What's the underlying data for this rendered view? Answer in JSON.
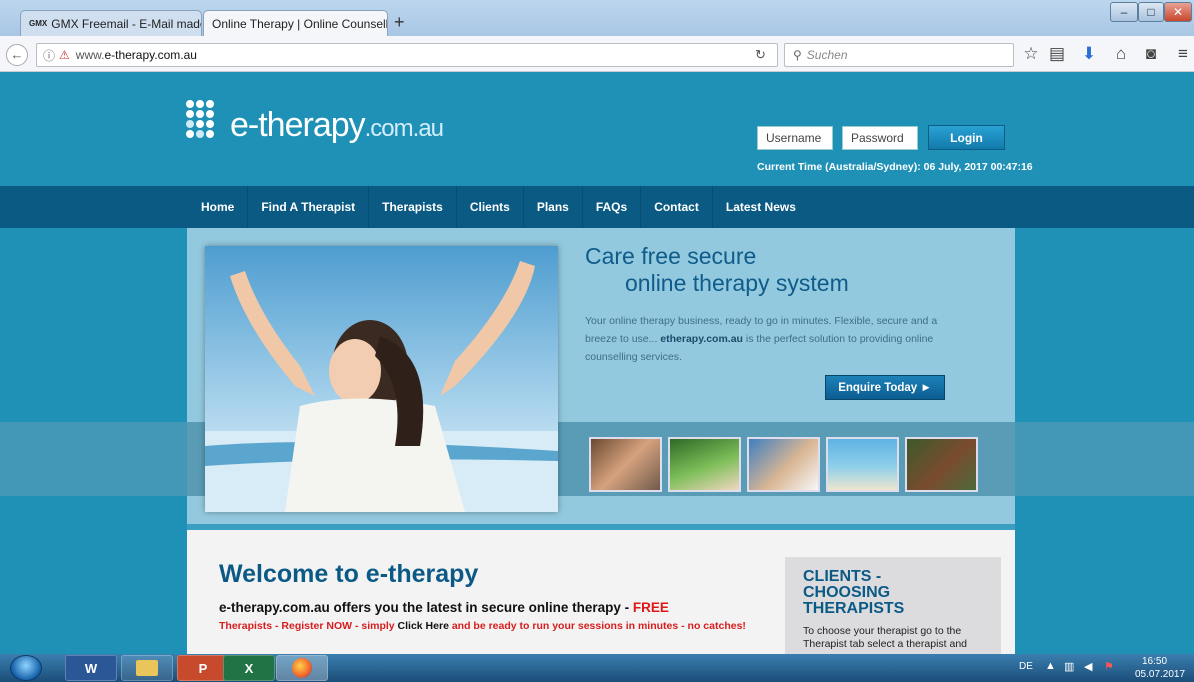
{
  "browser": {
    "tabs": [
      {
        "favicon": "GMX",
        "label": "GMX Freemail - E-Mail made",
        "close": "×"
      },
      {
        "label": "Online Therapy | Online Counsell",
        "close": "×"
      }
    ],
    "new_tab": "+",
    "window_buttons": [
      "–",
      "□",
      "✕"
    ],
    "url_prefix": "www.",
    "url_host": "e-therapy.com.au",
    "search_placeholder": "Suchen",
    "icons": [
      "back-icon",
      "info-icon",
      "reload-icon",
      "search-icon",
      "bookmark-star-icon",
      "reading-list-icon",
      "download-icon",
      "home-icon",
      "pocket-icon",
      "menu-icon"
    ]
  },
  "site": {
    "logo_main": "e-therapy",
    "logo_sub": ".com.au",
    "login": {
      "username_placeholder": "Username",
      "password_placeholder": "Password",
      "button": "Login"
    },
    "current_time": "Current Time (Australia/Sydney): 06 July, 2017 00:47:16",
    "nav": [
      "Home",
      "Find A Therapist",
      "Therapists",
      "Clients",
      "Plans",
      "FAQs",
      "Contact",
      "Latest News"
    ],
    "hero": {
      "headline_1": "Care free secure",
      "headline_2": "online therapy system",
      "text_1": "Your online therapy business, ready to go in minutes. Flexible, secure and a breeze to use... ",
      "text_bold": "etherapy.com.au",
      "text_2": " is the perfect solution to providing online counselling services.",
      "cta": "Enquire Today ►"
    },
    "welcome_title": "Welcome to e-therapy",
    "offers_text": "e-therapy.com.au offers you the latest in secure online therapy - ",
    "offers_free": "FREE",
    "register_1": "Therapists - Register NOW - simply ",
    "register_click": "Click Here",
    "register_2": " and be ready to run your sessions in minutes - no catches!",
    "sidebox": {
      "heading": "CLIENTS - CHOOSING THERAPISTS",
      "text": "To choose your therapist go to the Therapist tab select a therapist and"
    }
  },
  "taskbar": {
    "apps": [
      "W",
      "",
      "P",
      "X",
      ""
    ],
    "lang": "DE",
    "time": "16:50",
    "date": "05.07.2017"
  },
  "colors": {
    "site_bg": "#1f91b6",
    "nav_bg": "#0a5a83",
    "headline": "#0f5b8a",
    "free_red": "#e01717"
  }
}
